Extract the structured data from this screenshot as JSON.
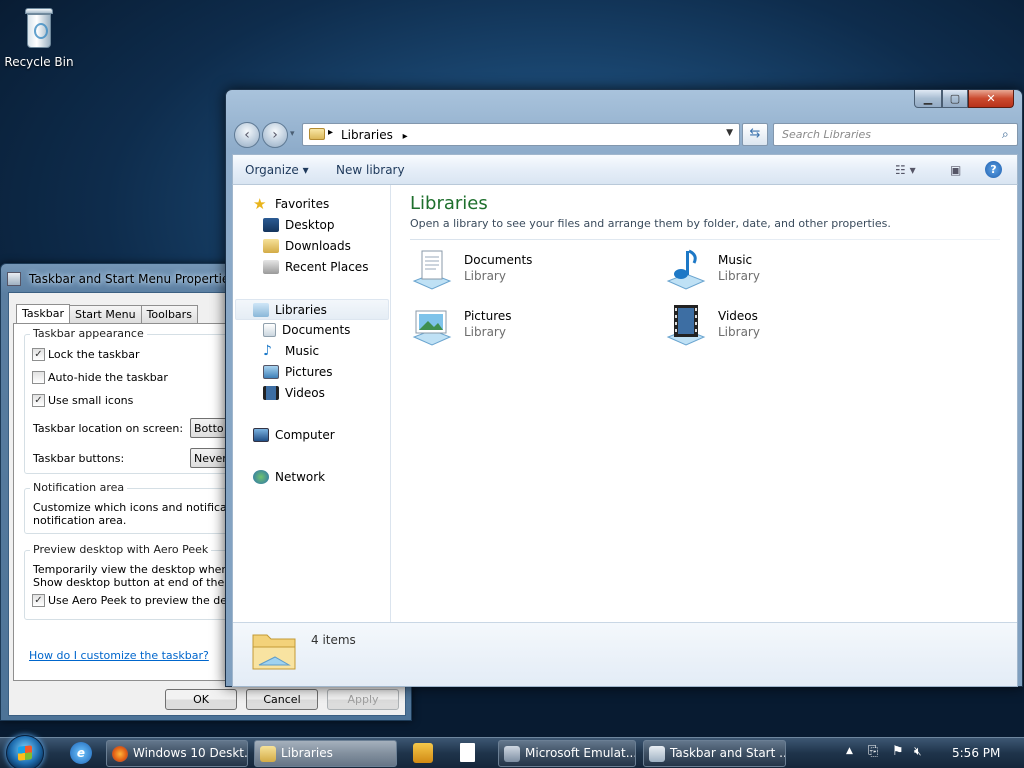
{
  "desktop": {
    "recycle_bin": "Recycle Bin"
  },
  "props_dialog": {
    "title": "Taskbar and Start Menu Properties",
    "tabs": [
      "Taskbar",
      "Start Menu",
      "Toolbars"
    ],
    "taskbar_appearance": {
      "heading": "Taskbar appearance",
      "lock": {
        "label": "Lock the taskbar",
        "checked": "✓"
      },
      "autohide": {
        "label": "Auto-hide the taskbar",
        "checked": ""
      },
      "small_icons": {
        "label": "Use small icons",
        "checked": "✓"
      },
      "location_label": "Taskbar location on screen:",
      "location_value": "Botto",
      "buttons_label": "Taskbar buttons:",
      "buttons_value": "Never"
    },
    "notification": {
      "heading": "Notification area",
      "line1": "Customize which icons and notifications",
      "line2": "notification area."
    },
    "peek": {
      "heading": "Preview desktop with Aero Peek",
      "line1": "Temporarily view the desktop when yo",
      "line2": "Show desktop button at end of the tas",
      "use_peek": {
        "label": "Use Aero Peek to preview the deskt",
        "checked": "✓"
      }
    },
    "help_link": "How do I customize the taskbar?",
    "buttons": {
      "ok": "OK",
      "cancel": "Cancel",
      "apply": "Apply"
    }
  },
  "explorer": {
    "address": {
      "crumb": "Libraries",
      "arrow": "▸"
    },
    "search_placeholder": "Search Libraries",
    "toolbar": {
      "organize": "Organize ▾",
      "new_library": "New library"
    },
    "nav": {
      "favorites": "Favorites",
      "desktop": "Desktop",
      "downloads": "Downloads",
      "recent": "Recent Places",
      "libraries": "Libraries",
      "documents": "Documents",
      "music": "Music",
      "pictures": "Pictures",
      "videos": "Videos",
      "computer": "Computer",
      "network": "Network"
    },
    "main": {
      "title": "Libraries",
      "subtitle": "Open a library to see your files and arrange them by folder, date, and other properties.",
      "items": [
        {
          "name": "Documents",
          "type": "Library"
        },
        {
          "name": "Music",
          "type": "Library"
        },
        {
          "name": "Pictures",
          "type": "Library"
        },
        {
          "name": "Videos",
          "type": "Library"
        }
      ]
    },
    "status": {
      "count": "4 items"
    }
  },
  "taskbar": {
    "buttons": {
      "firefox": "Windows 10 Deskt...",
      "libraries": "Libraries",
      "emulator": "Microsoft Emulat...",
      "props": "Taskbar and Start ..."
    },
    "clock": "5:56 PM"
  },
  "colors": {
    "title_green": "#1e6f2c",
    "link_blue": "#0066cc",
    "taskbar": "#1f344b"
  }
}
